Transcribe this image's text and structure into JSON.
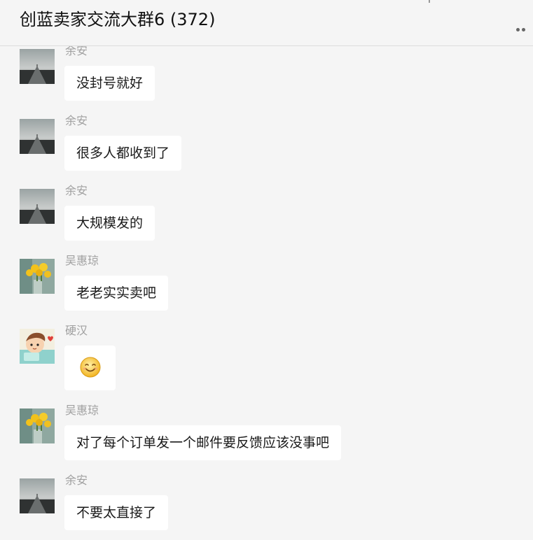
{
  "header": {
    "title": "创蓝卖家交流大群6 (372)",
    "more_icon": "more-dots-icon"
  },
  "messages": [
    {
      "sender": "余安",
      "text": "没封号就好",
      "avatar": "road-landscape-avatar"
    },
    {
      "sender": "余安",
      "text": "很多人都收到了",
      "avatar": "road-landscape-avatar"
    },
    {
      "sender": "余安",
      "text": "大规模发的",
      "avatar": "road-landscape-avatar"
    },
    {
      "sender": "吴惠琼",
      "text": "老老实实卖吧",
      "avatar": "yellow-flowers-avatar"
    },
    {
      "sender": "硬汉",
      "text": "",
      "emoji": "smiley-emoji-icon",
      "avatar": "cartoon-boy-avatar"
    },
    {
      "sender": "吴惠琼",
      "text": "对了每个订单发一个邮件要反馈应该没事吧",
      "avatar": "yellow-flowers-avatar"
    },
    {
      "sender": "余安",
      "text": "不要太直接了",
      "avatar": "road-landscape-avatar"
    }
  ]
}
